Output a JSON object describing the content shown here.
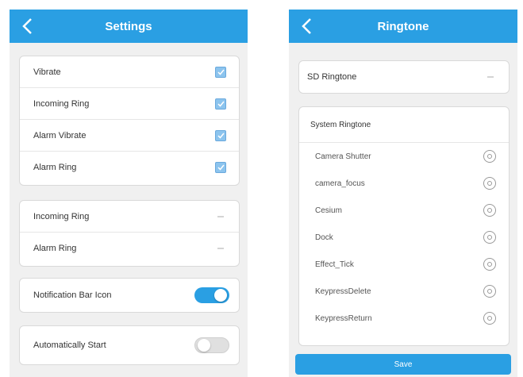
{
  "settings": {
    "title": "Settings",
    "checkbox_items": [
      {
        "label": "Vibrate",
        "checked": true
      },
      {
        "label": "Incoming Ring",
        "checked": true
      },
      {
        "label": "Alarm Vibrate",
        "checked": true
      },
      {
        "label": "Alarm Ring",
        "checked": true
      }
    ],
    "select_items": [
      {
        "label": "Incoming Ring"
      },
      {
        "label": "Alarm Ring"
      }
    ],
    "notification_bar_icon": {
      "label": "Notification Bar Icon",
      "on": true
    },
    "automatically_start": {
      "label": "Automatically Start",
      "on": false
    }
  },
  "ringtone": {
    "title": "Ringtone",
    "sd_ringtone_label": "SD Ringtone",
    "system_ringtone_label": "System Ringtone",
    "items": [
      "Camera Shutter",
      "camera_focus",
      "Cesium",
      "Dock",
      "Effect_Tick",
      "KeypressDelete",
      "KeypressReturn"
    ],
    "save_label": "Save"
  },
  "colors": {
    "accent": "#2a9fe3",
    "background": "#f0f0f0",
    "card": "#ffffff"
  }
}
